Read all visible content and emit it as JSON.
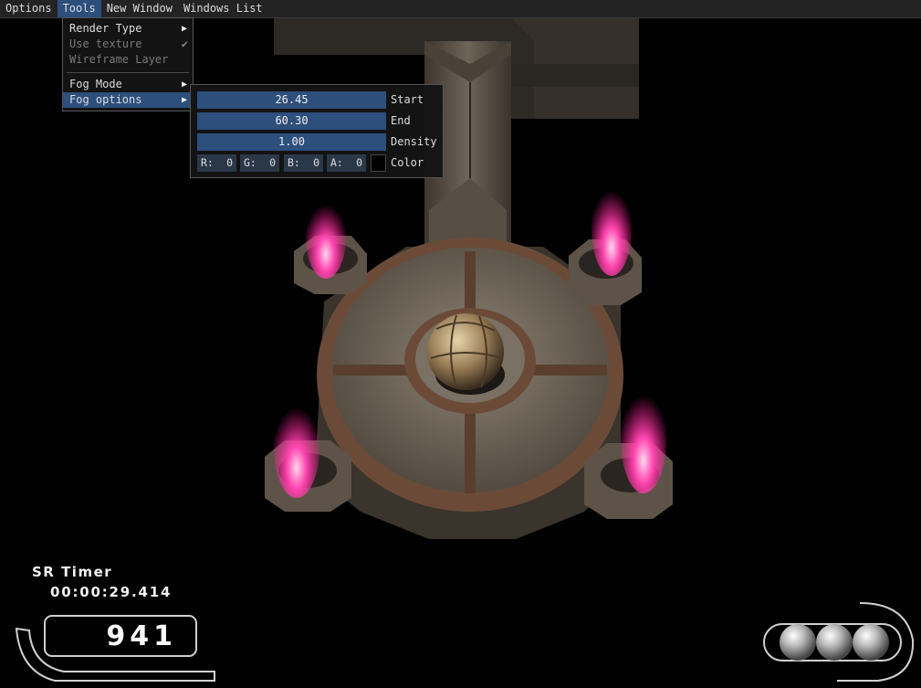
{
  "menubar": {
    "items": [
      {
        "label": "Options",
        "active": false
      },
      {
        "label": "Tools",
        "active": true
      },
      {
        "label": "New Window",
        "active": false
      },
      {
        "label": "Windows List",
        "active": false
      }
    ]
  },
  "tools_menu": {
    "render_type": "Render Type",
    "use_texture": "Use texture",
    "wireframe_layer": "Wireframe Layer",
    "fog_mode": "Fog Mode",
    "fog_options": "Fog options"
  },
  "fog_options": {
    "start": {
      "label": "Start",
      "value": "26.45"
    },
    "end": {
      "label": "End",
      "value": "60.30"
    },
    "density": {
      "label": "Density",
      "value": "1.00"
    },
    "color": {
      "label": "Color",
      "r_label": "R:",
      "r": "0",
      "g_label": "G:",
      "g": "0",
      "b_label": "B:",
      "b": "0",
      "a_label": "A:",
      "a": "0",
      "swatch": "#000000"
    }
  },
  "hud": {
    "timer_title": "SR Timer",
    "timer_value": "00:00:29.414",
    "score": "941",
    "lives_remaining": 3
  },
  "colors": {
    "accent": "#2c4f7c",
    "flame": "#ff2fa0",
    "stone": "#6e6458",
    "brick": "#6b4b38"
  }
}
